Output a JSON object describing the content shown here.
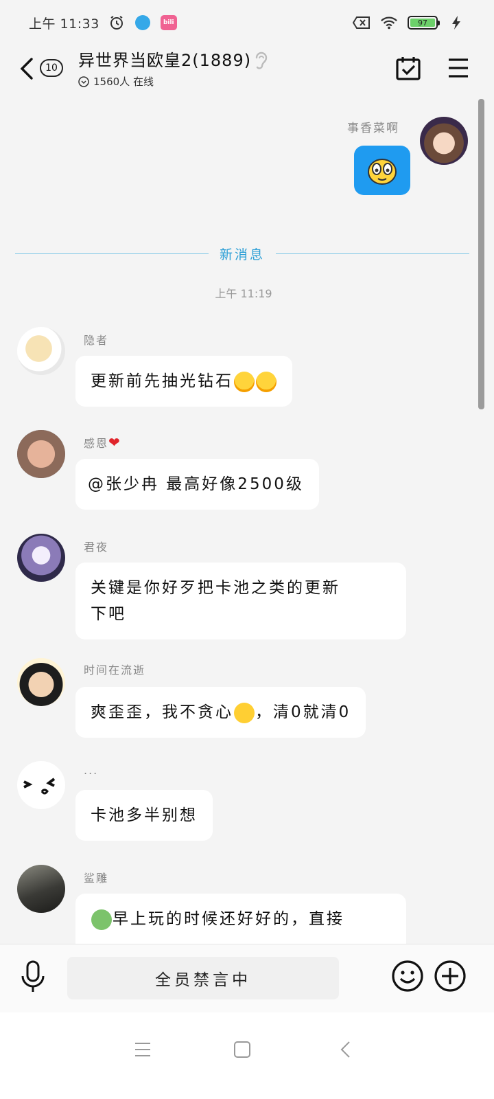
{
  "status_bar": {
    "time": "上午 11:33",
    "battery": "97"
  },
  "header": {
    "unread_count": "10",
    "title": "异世界当欧皇2(1889)",
    "online": "1560人 在线"
  },
  "messages_top": {
    "my_name": "事香菜啊"
  },
  "divider": {
    "label": "新消息"
  },
  "timestamp": "上午 11:19",
  "messages": [
    {
      "sender": "隐者",
      "text": "更新前先抽光钻石"
    },
    {
      "sender": "感恩",
      "text": "@张少冉 最高好像2500级"
    },
    {
      "sender": "君夜",
      "text_line1": "关键是你好歹把卡池之类的更新",
      "text_line2": "下吧"
    },
    {
      "sender": "时间在流逝",
      "text_a": "爽歪歪，我不贪心",
      "text_b": "，清0就清0"
    },
    {
      "sender": "...",
      "text": "卡池多半别想"
    },
    {
      "sender": "鲨雕",
      "text": "早上玩的时候还好好的，直接"
    }
  ],
  "input_bar": {
    "muted_text": "全员禁言中"
  },
  "colors": {
    "accent_blue": "#1f9bf0",
    "divider_blue": "#2d9fd6"
  }
}
